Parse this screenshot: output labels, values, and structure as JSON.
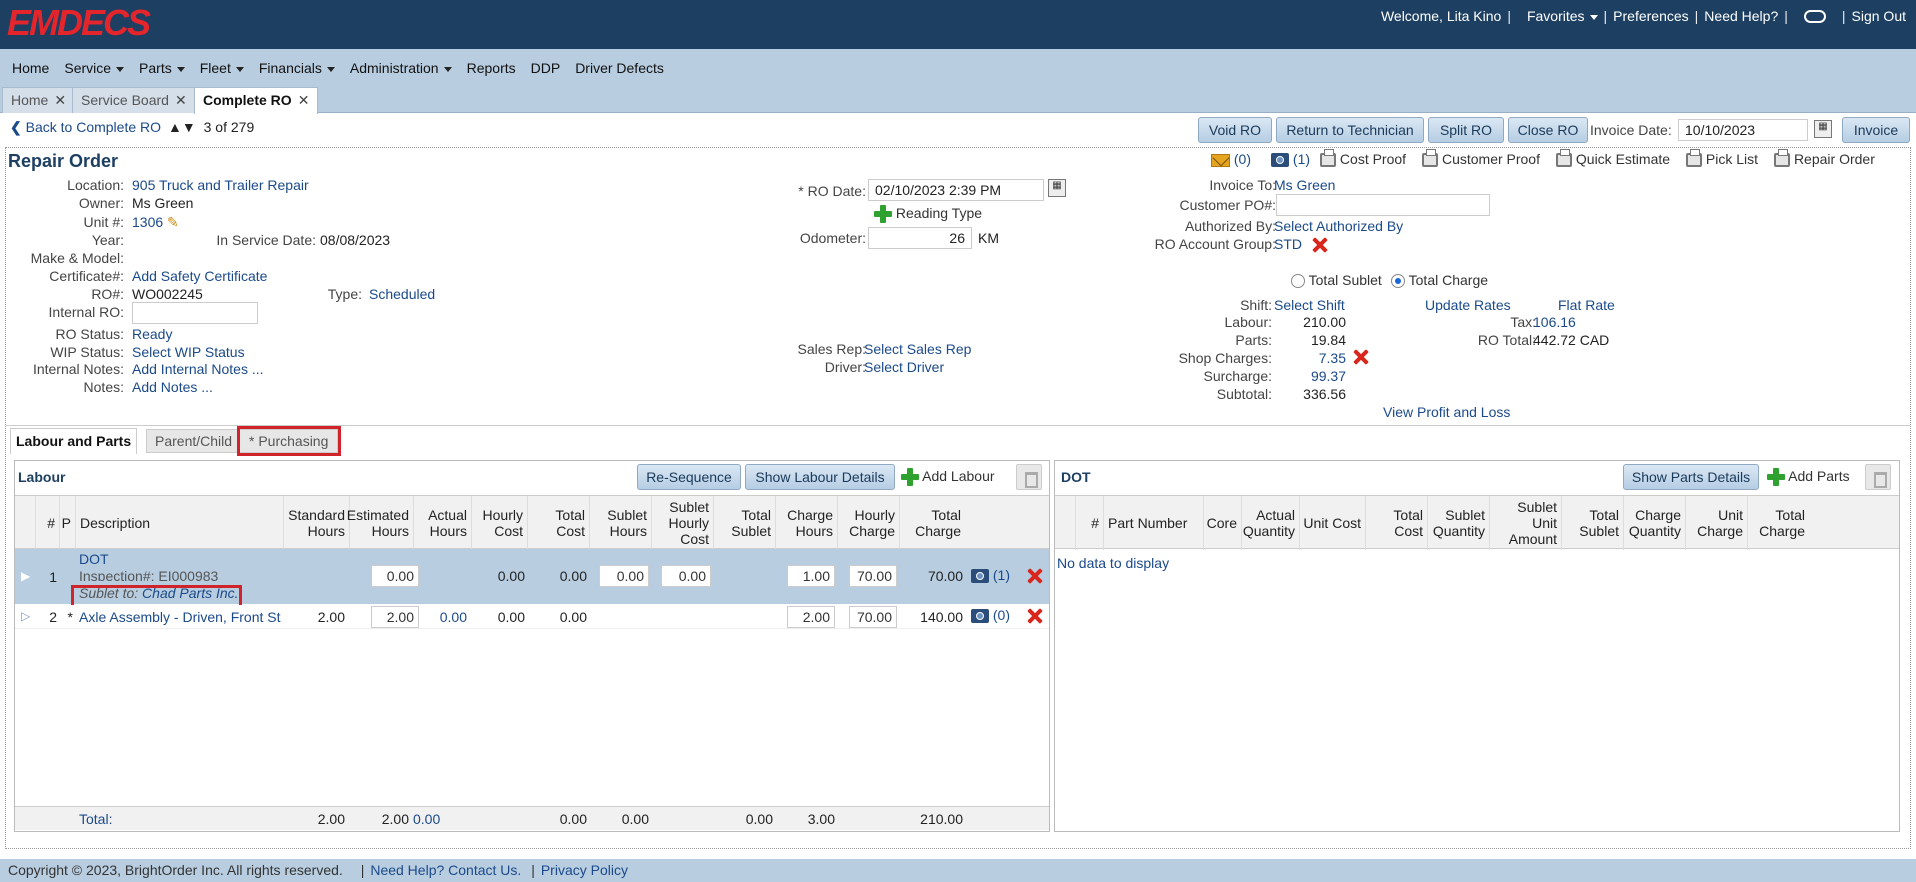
{
  "app": {
    "logo": "EMDECS"
  },
  "topbar": {
    "welcome": "Welcome, Lita Kino",
    "favorites": "Favorites",
    "preferences": "Preferences",
    "help": "Need Help?",
    "signout": "Sign Out"
  },
  "menu": [
    {
      "label": "Home"
    },
    {
      "label": "Service"
    },
    {
      "label": "Parts"
    },
    {
      "label": "Fleet"
    },
    {
      "label": "Financials"
    },
    {
      "label": "Administration"
    },
    {
      "label": "Reports"
    },
    {
      "label": "DDP"
    },
    {
      "label": "Driver Defects"
    }
  ],
  "tabs": [
    {
      "label": "Home"
    },
    {
      "label": "Service Board"
    },
    {
      "label": "Complete RO"
    }
  ],
  "nav": {
    "back": "Back to Complete RO",
    "position": "3",
    "of": "of",
    "total": "279"
  },
  "actions": {
    "void": "Void RO",
    "return": "Return to Technician",
    "split": "Split RO",
    "close": "Close RO",
    "invoice_date_label": "Invoice Date:",
    "invoice_date": "10/10/2023",
    "invoice": "Invoice"
  },
  "ro": {
    "title": "Repair Order",
    "location_label": "Location:",
    "location": "905 Truck and Trailer Repair",
    "owner_label": "Owner:",
    "owner": "Ms Green",
    "unit_label": "Unit #:",
    "unit": "1306",
    "year_label": "Year:",
    "service_date_label": "In Service Date:",
    "service_date": "08/08/2023",
    "make_label": "Make & Model:",
    "cert_label": "Certificate#:",
    "cert": "Add Safety Certificate",
    "ro_num_label": "RO#:",
    "ro_num": "WO002245",
    "type_label": "Type:",
    "type": "Scheduled",
    "internal_ro_label": "Internal RO:",
    "status_label": "RO Status:",
    "status": "Ready",
    "wip_label": "WIP Status:",
    "wip": "Select WIP Status",
    "internal_notes_label": "Internal Notes:",
    "internal_notes": "Add Internal Notes ...",
    "notes_label": "Notes:",
    "notes": "Add Notes ...",
    "ro_date_label": "* RO Date:",
    "ro_date": "02/10/2023 2:39 PM",
    "reading_type": "Reading Type",
    "odometer_label": "Odometer:",
    "odometer": "26",
    "odometer_unit": "KM",
    "sales_rep_label": "Sales Rep:",
    "sales_rep": "Select Sales Rep",
    "driver_label": "Driver:",
    "driver": "Select Driver"
  },
  "toolicons": {
    "mail_count": "(0)",
    "cam_count": "(1)",
    "cost_proof": "Cost Proof",
    "customer_proof": "Customer Proof",
    "quick_estimate": "Quick Estimate",
    "pick_list": "Pick List",
    "repair_order": "Repair Order"
  },
  "invoice": {
    "invoice_to_label": "Invoice To:",
    "invoice_to": "Ms Green",
    "po_label": "Customer PO#:",
    "auth_label": "Authorized By:",
    "auth": "Select Authorized By",
    "group_label": "RO Account Group:",
    "group": "STD",
    "total_sublet": "Total Sublet",
    "total_charge": "Total Charge",
    "shift_label": "Shift:",
    "shift": "Select Shift",
    "update_rates": "Update Rates",
    "flat_rate": "Flat Rate",
    "labour_label": "Labour:",
    "labour": "210.00",
    "parts_label": "Parts:",
    "parts": "19.84",
    "shop_label": "Shop Charges:",
    "shop": "7.35",
    "surcharge_label": "Surcharge:",
    "surcharge": "99.37",
    "subtotal_label": "Subtotal:",
    "subtotal": "336.56",
    "tax_label": "Tax:",
    "tax": "106.16",
    "rototal_label": "RO Total:",
    "rototal": "442.72",
    "currency": "CAD",
    "profit": "View Profit and Loss"
  },
  "subtabs": [
    {
      "label": "Labour and Parts"
    },
    {
      "label": "Parent/Child"
    },
    {
      "label": "* Purchasing"
    }
  ],
  "labour": {
    "title": "Labour",
    "resequence": "Re-Sequence",
    "show_details": "Show Labour Details",
    "add": "Add Labour",
    "headers": [
      "#",
      "P",
      "Description",
      "Standard Hours",
      "Estimated Hours",
      "Actual Hours",
      "Hourly Cost",
      "Total Cost",
      "Sublet Hours",
      "Sublet Hourly Cost",
      "Total Sublet",
      "Charge Hours",
      "Hourly Charge",
      "Total Charge"
    ],
    "rows": [
      {
        "num": "1",
        "p": "",
        "desc": "DOT",
        "sub": "Inspection#:  EI000983",
        "sublet_label": "Sublet to:",
        "sublet_to": "Chad Parts Inc.",
        "std": "",
        "est": "0.00",
        "act": "",
        "hcost": "0.00",
        "tcost": "0.00",
        "shours": "0.00",
        "shcost": "0.00",
        "tsub": "",
        "chours": "1.00",
        "hcharge": "70.00",
        "tcharge": "70.00",
        "cam": "(1)"
      },
      {
        "num": "2",
        "p": "*",
        "desc": "Axle Assembly - Driven, Front St",
        "std": "2.00",
        "est": "2.00",
        "act": "0.00",
        "hcost": "0.00",
        "tcost": "0.00",
        "shours": "",
        "shcost": "",
        "tsub": "",
        "chours": "2.00",
        "hcharge": "70.00",
        "tcharge": "140.00",
        "cam": "(0)"
      }
    ],
    "total": {
      "label": "Total:",
      "std": "2.00",
      "est": "2.00",
      "act": "0.00",
      "tcost": "0.00",
      "shours": "0.00",
      "tsub": "0.00",
      "chours": "3.00",
      "tcharge": "210.00"
    }
  },
  "parts": {
    "title": "DOT",
    "show_details": "Show Parts Details",
    "add": "Add Parts",
    "headers": [
      "#",
      "Part Number",
      "Core",
      "Actual Quantity",
      "Unit Cost",
      "Total Cost",
      "Sublet Quantity",
      "Sublet Unit Amount",
      "Total Sublet",
      "Charge Quantity",
      "Unit Charge",
      "Total Charge"
    ],
    "empty": "No data to display"
  },
  "footer": {
    "copyright": "Copyright © 2023, BrightOrder Inc. All rights reserved.",
    "help": "Need Help? Contact Us.",
    "privacy": "Privacy Policy"
  }
}
